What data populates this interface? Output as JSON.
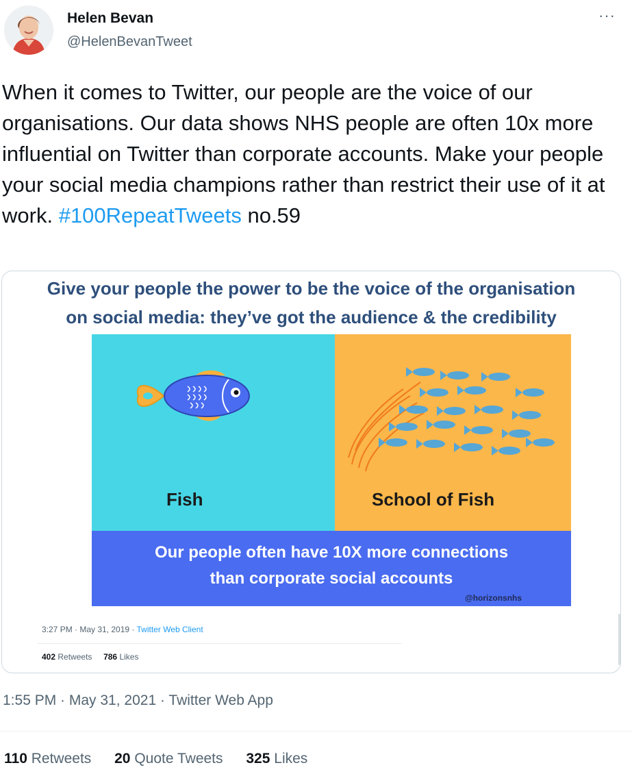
{
  "author": {
    "name": "Helen Bevan",
    "handle": "@HelenBevanTweet"
  },
  "menu": {
    "more_label": "···"
  },
  "tweet": {
    "text": "When it comes to Twitter, our people are the voice of our organisations. Our data shows NHS people are often 10x more influential on Twitter than corporate accounts. Make your people your social media champions rather than restrict their use of it at work.",
    "hashtag": "#100RepeatTweets",
    "suffix": " no.59"
  },
  "media": {
    "title_line1": "Give your people the power to be the voice of the organisation",
    "title_line2": "on social media:  they’ve got the audience & the credibility",
    "left_label": "Fish",
    "right_label": "School of Fish",
    "bottom_line1": "Our people often have 10X more connections",
    "bottom_line2": "than corporate social accounts",
    "credit": "@horizonsnhs",
    "inner_time": "3:27 PM · May 31, 2019 · ",
    "inner_source": "Twitter Web Client",
    "inner_retweets_count": "402",
    "inner_retweets_label": "Retweets",
    "inner_likes_count": "786",
    "inner_likes_label": "Likes"
  },
  "timestamp": "1:55 PM · May 31, 2021 · Twitter Web App",
  "stats": {
    "retweets_count": "110",
    "retweets_label": "Retweets",
    "quotes_count": "20",
    "quotes_label": "Quote Tweets",
    "likes_count": "325",
    "likes_label": "Likes"
  },
  "colors": {
    "link": "#1d9bf0",
    "panel_cyan": "#47d6e5",
    "panel_orange": "#fbb74a",
    "panel_blue": "#4a6cf0",
    "title_navy": "#2e4f7b"
  }
}
